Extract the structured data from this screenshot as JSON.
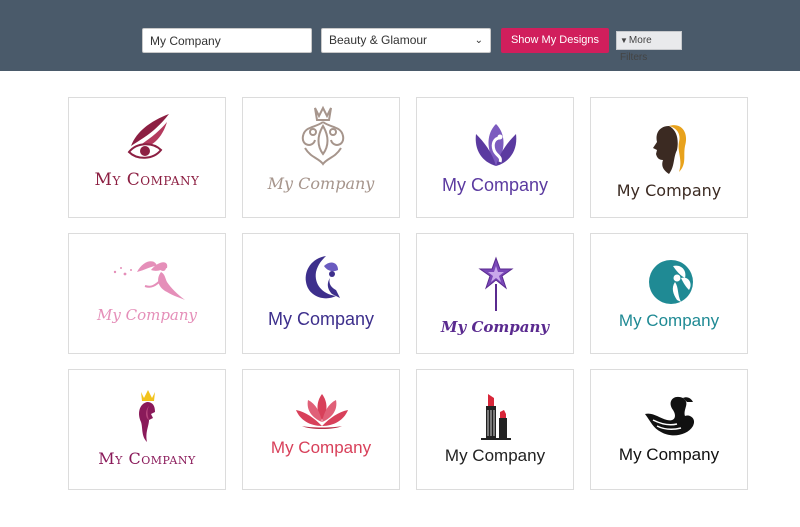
{
  "search": {
    "company_value": "My Company",
    "category_value": "Beauty & Glamour",
    "show_label": "Show My Designs",
    "filters_label": "More Filters"
  },
  "colors": {
    "topbar": "#4a5a6a",
    "accent": "#d11e5c"
  },
  "logos": [
    {
      "name": "My Company",
      "icon": "eye-feather-icon",
      "color": "#8c1f42"
    },
    {
      "name": "My Company",
      "icon": "ornamental-crown-icon",
      "color": "#a6958c"
    },
    {
      "name": "My Company",
      "icon": "lotus-swan-icon",
      "color": "#5b3aa0"
    },
    {
      "name": "My Company",
      "icon": "woman-profile-icon",
      "color": "#3b2a22"
    },
    {
      "name": "My Company",
      "icon": "fairy-icon",
      "color": "#e58fb9"
    },
    {
      "name": "My Company",
      "icon": "moon-fairy-icon",
      "color": "#3d2f8c"
    },
    {
      "name": "My Company",
      "icon": "star-wand-icon",
      "color": "#5a2a8f"
    },
    {
      "name": "My Company",
      "icon": "circle-fairy-icon",
      "color": "#1f8a94"
    },
    {
      "name": "My Company",
      "icon": "crowned-woman-icon",
      "color": "#8a1a5a"
    },
    {
      "name": "My Company",
      "icon": "lotus-flower-icon",
      "color": "#d8405a"
    },
    {
      "name": "My Company",
      "icon": "lipstick-icon",
      "color": "#222222"
    },
    {
      "name": "My Company",
      "icon": "swan-icon",
      "color": "#111111"
    }
  ]
}
